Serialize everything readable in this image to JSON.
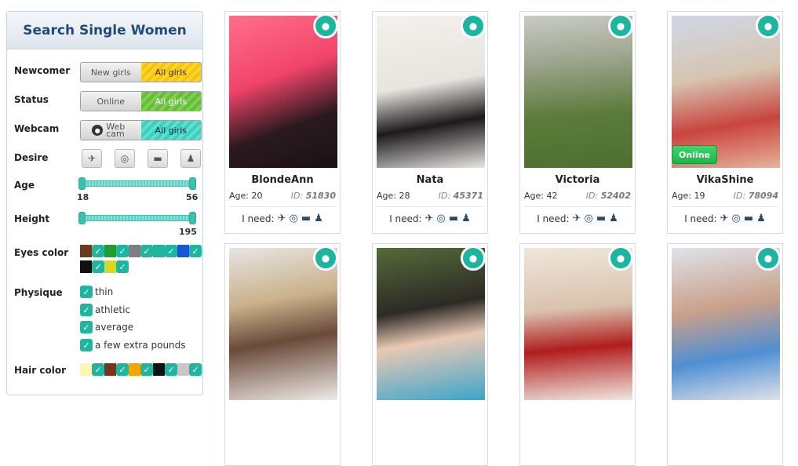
{
  "sidebar": {
    "title": "Search Single Women",
    "newcomer": {
      "label": "Newcomer",
      "opt_a": "New girls",
      "opt_b": "All girls"
    },
    "status": {
      "label": "Status",
      "opt_a": "Online",
      "opt_b": "All girls"
    },
    "webcam": {
      "label": "Webcam",
      "opt_a": "Web cam",
      "opt_b": "All girls"
    },
    "desire": {
      "label": "Desire",
      "icons": [
        "plane-icon",
        "rings-icon",
        "chat-icon",
        "users-icon"
      ]
    },
    "age": {
      "label": "Age",
      "min": "18",
      "max": "56"
    },
    "height": {
      "label": "Height",
      "max": "195"
    },
    "eyes": {
      "label": "Eyes color",
      "colors": [
        "#6b3a1f",
        "#1f9e2b",
        "#7a7f86",
        "#1fb59f",
        "#1a57d6",
        "#111111",
        "#d7d820"
      ]
    },
    "physique": {
      "label": "Physique",
      "options": [
        "thin",
        "athletic",
        "average",
        "a few extra pounds"
      ]
    },
    "hair": {
      "label": "Hair color",
      "colors": [
        "#fdf6b6",
        "#7a3417",
        "#f0a800",
        "#111111",
        "#c8c8c8"
      ]
    }
  },
  "cards": [
    {
      "name": "BlondeAnn",
      "age": "Age: 20",
      "id_prefix": "ID:",
      "id": "51830",
      "need": "I need:",
      "online": ""
    },
    {
      "name": "Nata",
      "age": "Age: 28",
      "id_prefix": "ID:",
      "id": "45371",
      "need": "I need:",
      "online": ""
    },
    {
      "name": "Victoria",
      "age": "Age: 42",
      "id_prefix": "ID:",
      "id": "52402",
      "need": "I need:",
      "online": ""
    },
    {
      "name": "VikaShine",
      "age": "Age: 19",
      "id_prefix": "ID:",
      "id": "78094",
      "need": "I need:",
      "online": "Online"
    }
  ],
  "colors": {
    "accent": "#1fb59f",
    "title": "#21497a"
  }
}
